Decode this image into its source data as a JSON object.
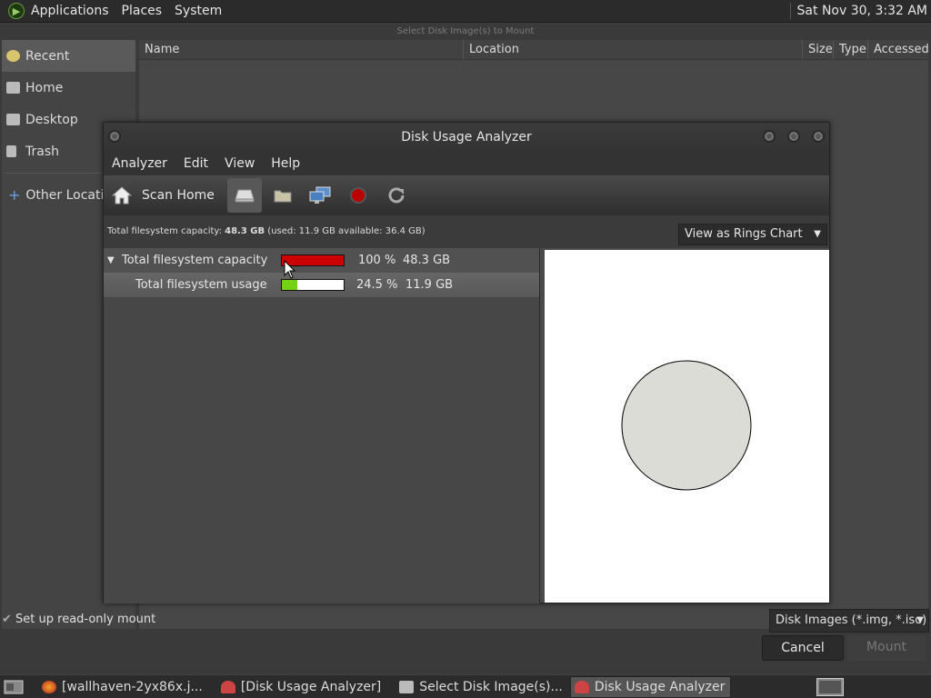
{
  "top_panel": {
    "menus": [
      "Applications",
      "Places",
      "System"
    ],
    "clock": "Sat Nov 30,  3:32 AM"
  },
  "chooser": {
    "title": "Select Disk Image(s) to Mount",
    "sidebar": [
      {
        "label": "Recent",
        "icon": "clock-icon",
        "selected": true
      },
      {
        "label": "Home",
        "icon": "home-folder-icon"
      },
      {
        "label": "Desktop",
        "icon": "desktop-folder-icon"
      },
      {
        "label": "Trash",
        "icon": "trash-icon"
      },
      {
        "label": "Other Locations",
        "icon": "plus-icon"
      }
    ],
    "columns": [
      "Name",
      "Location",
      "Size",
      "Type",
      "Accessed"
    ],
    "readonly_label": "Set up read-only mount",
    "filter": "Disk Images (*.img, *.iso)",
    "cancel": "Cancel",
    "mount": "Mount"
  },
  "dua": {
    "title": "Disk Usage Analyzer",
    "menus": [
      "Analyzer",
      "Edit",
      "View",
      "Help"
    ],
    "scan_home": "Scan Home",
    "status": {
      "prefix": "Total filesystem capacity: ",
      "capacity": "48.3 GB",
      "suffix": " (used: 11.9 GB available: 36.4 GB)"
    },
    "view_mode": "View as Rings Chart",
    "rows": [
      {
        "name": "Total filesystem capacity",
        "percent": "100 %",
        "size": "48.3 GB",
        "fill": 1.0,
        "color": "#cc0000"
      },
      {
        "name": "Total filesystem usage",
        "percent": "24.5 %",
        "size": "11.9 GB",
        "fill": 0.245,
        "color": "#73d216"
      }
    ]
  },
  "taskbar": {
    "tasks": [
      {
        "label": "[wallhaven-2yx86x.j...",
        "icon": "firefox-icon"
      },
      {
        "label": "[Disk Usage Analyzer]",
        "icon": "disk-usage-icon"
      },
      {
        "label": "Select Disk Image(s)...",
        "icon": "window-icon"
      },
      {
        "label": "Disk Usage Analyzer",
        "icon": "disk-usage-icon",
        "active": true
      }
    ]
  }
}
